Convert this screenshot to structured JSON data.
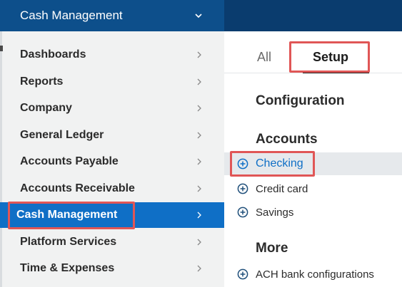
{
  "module_selector": {
    "label": "Cash Management",
    "icon": "chevron-down-icon"
  },
  "left_menu": {
    "items": [
      {
        "label": "Dashboards",
        "active": false
      },
      {
        "label": "Reports",
        "active": false
      },
      {
        "label": "Company",
        "active": false
      },
      {
        "label": "General Ledger",
        "active": false
      },
      {
        "label": "Accounts Payable",
        "active": false
      },
      {
        "label": "Accounts Receivable",
        "active": false
      },
      {
        "label": "Cash Management",
        "active": true
      },
      {
        "label": "Platform Services",
        "active": false
      },
      {
        "label": "Time & Expenses",
        "active": false
      }
    ],
    "item_icon": "chevron-right-icon"
  },
  "tabs": [
    {
      "label": "All",
      "selected": false
    },
    {
      "label": "Setup",
      "selected": true
    }
  ],
  "sections": {
    "configuration": {
      "title": "Configuration"
    },
    "accounts": {
      "title": "Accounts",
      "links": [
        {
          "label": "Checking",
          "highlighted": true
        },
        {
          "label": "Credit card",
          "highlighted": false
        },
        {
          "label": "Savings",
          "highlighted": false
        }
      ]
    },
    "more": {
      "title": "More",
      "links": [
        {
          "label": "ACH bank configurations",
          "highlighted": false
        }
      ]
    }
  },
  "colors": {
    "topbar": "#0a3c6e",
    "module_selector": "#0d4f8b",
    "active_item": "#0f6fc6",
    "link_accent": "#0f6fc6",
    "annotation_frame": "#e05656",
    "menu_background": "#f1f2f2"
  }
}
